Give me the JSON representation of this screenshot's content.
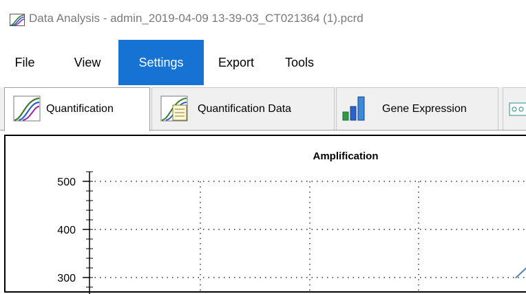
{
  "window": {
    "title": "Data Analysis - admin_2019-04-09 13-39-03_CT021364 (1).pcrd",
    "app_icon": "amplification-curves-icon"
  },
  "menu": {
    "items": [
      {
        "label": "File"
      },
      {
        "label": "View"
      },
      {
        "label": "Settings",
        "active": true
      },
      {
        "label": "Export"
      },
      {
        "label": "Tools"
      }
    ],
    "active_color": "#1672d3"
  },
  "tabs": [
    {
      "label": "Quantification",
      "icon": "amplification-curves-icon",
      "active": true
    },
    {
      "label": "Quantification Data",
      "icon": "curves-with-sheet-icon"
    },
    {
      "label": "Gene Expression",
      "icon": "bar-chart-icon"
    },
    {
      "label": "",
      "icon": "partial-tab-icon"
    }
  ],
  "chart_data": {
    "type": "line",
    "title": "Amplification",
    "yticks": [
      300,
      400,
      500
    ],
    "grid": true,
    "series": [
      {
        "color": "#4a7fb5",
        "x": [
          0.955,
          1.0
        ],
        "y": [
          299,
          338
        ]
      }
    ]
  }
}
